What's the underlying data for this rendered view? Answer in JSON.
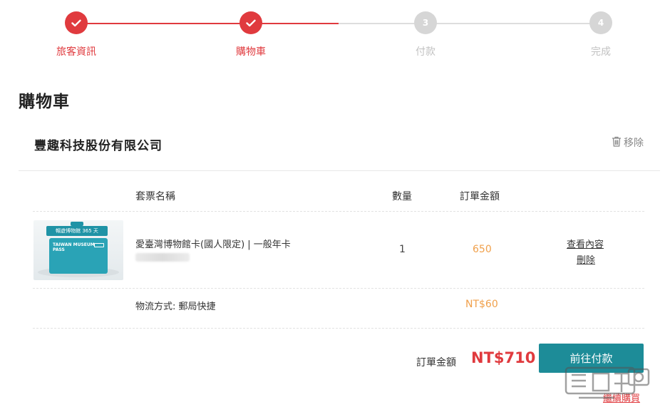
{
  "stepper": {
    "steps": [
      {
        "label": "旅客資訊",
        "status": "done",
        "number": ""
      },
      {
        "label": "購物車",
        "status": "done",
        "number": ""
      },
      {
        "label": "付款",
        "status": "todo",
        "number": "3"
      },
      {
        "label": "完成",
        "status": "todo",
        "number": "4"
      }
    ],
    "done_color": "#e03a3e",
    "todo_color": "#d6d6d6"
  },
  "page": {
    "title": "購物車"
  },
  "vendor": {
    "name": "豐趣科技股份有限公司",
    "remove_label": "移除"
  },
  "table": {
    "headers": {
      "ticket_name": "套票名稱",
      "quantity": "數量",
      "order_amount": "訂單金額"
    },
    "item": {
      "image_banner": "暢遊博物館 365 天",
      "image_card_text": "TAIWAN MUSEUM PASS",
      "name": "愛臺灣博物館卡(國人限定) | 一般年卡",
      "quantity": "1",
      "amount": "650",
      "view_label": "查看內容",
      "delete_label": "刪除"
    },
    "shipping": {
      "label": "物流方式: 郵局快捷",
      "fee": "NT$60"
    }
  },
  "summary": {
    "total_label": "訂單金額",
    "total_value": "NT$710",
    "pay_button": "前往付款",
    "continue_label": "繼續購買"
  },
  "colors": {
    "accent_red": "#e03a3e",
    "teal_button": "#1d8c98",
    "amount_orange": "#f0a04b"
  }
}
